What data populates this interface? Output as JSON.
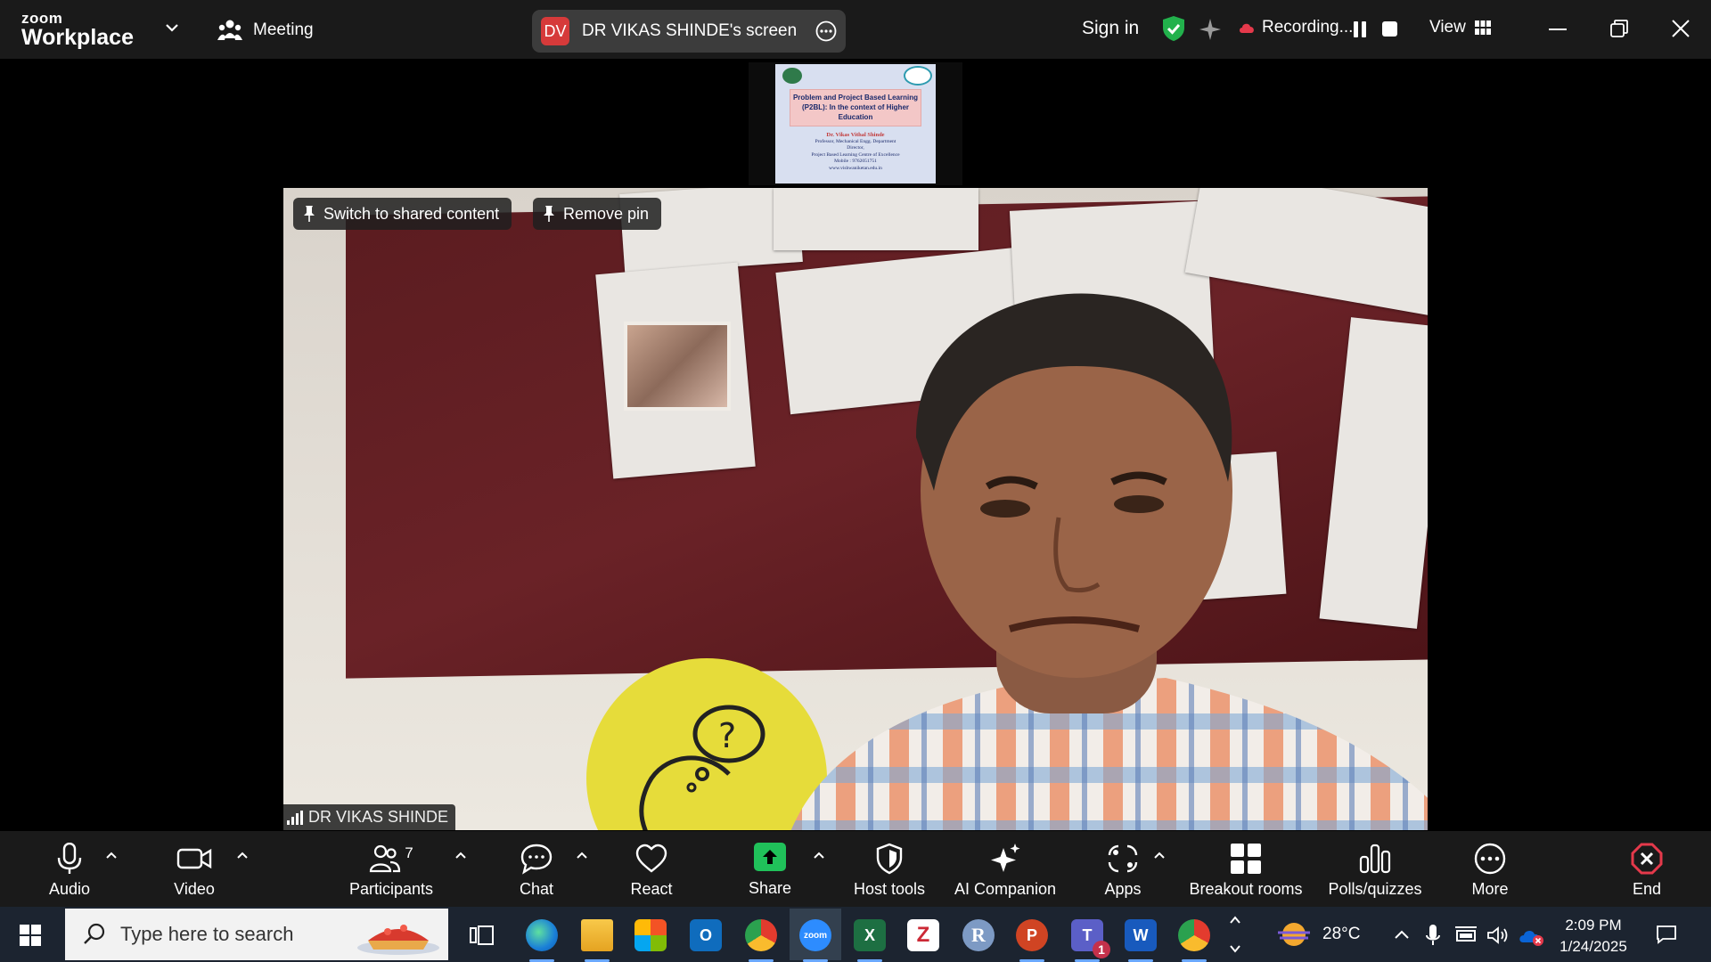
{
  "titlebar": {
    "logo_top": "zoom",
    "logo_bottom": "Workplace",
    "meeting_label": "Meeting",
    "screen_initials": "DV",
    "screen_label": "DR VIKAS SHINDE's screen",
    "signin": "Sign in",
    "recording": "Recording...",
    "view": "View"
  },
  "slide": {
    "title": "Problem and Project Based Learning (P2BL): In the context of Higher Education",
    "author": "Dr. Vikas Vithal Shinde",
    "lines": [
      "Professor, Mechanical Engg. Department",
      "Director,",
      "Project Based Learning Centre of Excellence",
      "Mobile : 9762051751",
      "www.vishwaniketan.edu.in"
    ]
  },
  "video": {
    "switch_label": "Switch to shared content",
    "remove_pin_label": "Remove pin",
    "participant_name": "DR VIKAS SHINDE"
  },
  "toolbar": {
    "audio": "Audio",
    "video": "Video",
    "participants": "Participants",
    "participants_count": "7",
    "chat": "Chat",
    "react": "React",
    "share": "Share",
    "host_tools": "Host tools",
    "ai_companion": "AI Companion",
    "apps": "Apps",
    "breakout": "Breakout rooms",
    "polls": "Polls/quizzes",
    "more": "More",
    "end": "End"
  },
  "taskbar": {
    "search_placeholder": "Type here to search",
    "weather": "28°C",
    "time": "2:09 PM",
    "date": "1/24/2025",
    "teams_badge": "1",
    "zoom_label": "zoom",
    "icons": [
      "task-view-icon",
      "edge-icon",
      "file-explorer-icon",
      "store-icon",
      "outlook-icon",
      "chrome-icon",
      "zoom-icon",
      "excel-icon",
      "zotero-icon",
      "r-icon",
      "powerpoint-icon",
      "teams-icon",
      "word-icon",
      "chrome-profile-icon"
    ]
  },
  "colors": {
    "toolbar_bg": "#1a1a1a",
    "share_green": "#20c15a",
    "end_red": "#e5394b",
    "shield_green": "#22b14c",
    "taskbar_bg": "#1c2430"
  }
}
